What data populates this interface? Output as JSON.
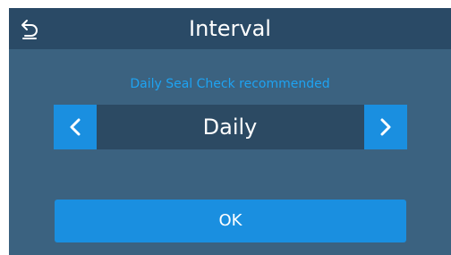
{
  "header": {
    "title": "Interval",
    "back_icon": "back-arrow-icon"
  },
  "hint": "Daily Seal Check recommended",
  "selector": {
    "value": "Daily",
    "prev_icon": "chevron-left-icon",
    "next_icon": "chevron-right-icon"
  },
  "ok_label": "OK",
  "colors": {
    "header_bg": "#2a4a66",
    "screen_bg": "#3b6280",
    "accent": "#1a8fe0",
    "hint_text": "#1ea3f2",
    "selector_bg": "#2c4a63"
  }
}
